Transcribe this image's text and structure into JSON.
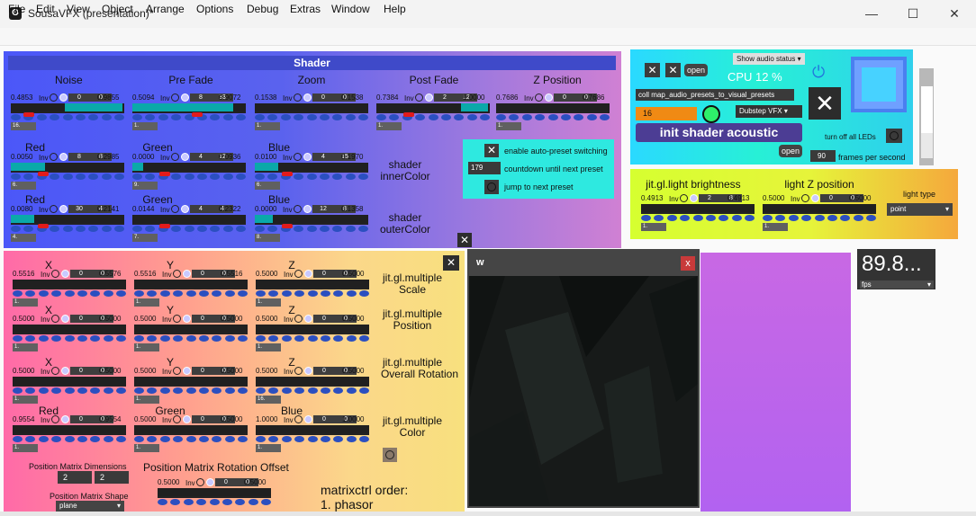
{
  "window": {
    "title": "SousaVFX (presentation)*",
    "min_icon": "minimize-icon",
    "max_icon": "maximize-icon",
    "close_icon": "close-icon"
  },
  "menu": [
    "File",
    "Edit",
    "View",
    "Object",
    "Arrange",
    "Options",
    "Debug",
    "Extras",
    "Window",
    "Help"
  ],
  "shader": {
    "header": "Shader",
    "params": [
      {
        "label": "Noise",
        "left": "0.4853",
        "inv": "Inv",
        "n1": "0",
        "n2": "0",
        "right": "0.9855",
        "msg": "16."
      },
      {
        "label": "Pre Fade",
        "left": "0.5094",
        "inv": "Inv",
        "n1": "8",
        "n2": "33",
        "right": "0.9072",
        "msg": "1."
      },
      {
        "label": "Zoom",
        "left": "0.1538",
        "inv": "Inv",
        "n1": "0",
        "n2": "0",
        "right": "0.1538",
        "msg": "1."
      },
      {
        "label": "Post Fade",
        "left": "0.7384",
        "inv": "Inv",
        "n1": "2",
        "n2": "12",
        "right": "1.0000",
        "msg": "1."
      },
      {
        "label": "Z Position",
        "left": "0.7686",
        "inv": "Inv",
        "n1": "0",
        "n2": "0",
        "right": "0.7686",
        "msg": "1."
      }
    ],
    "inner": [
      {
        "label": "Red",
        "left": "0.0050",
        "inv": "Inv",
        "n1": "8",
        "n2": "8",
        "right": "0.2985",
        "msg": "6."
      },
      {
        "label": "Green",
        "left": "0.0000",
        "inv": "Inv",
        "n1": "4",
        "n2": "12",
        "right": "0.0936",
        "msg": "9."
      },
      {
        "label": "Blue",
        "left": "0.0100",
        "inv": "Inv",
        "n1": "4",
        "n2": "15",
        "right": "0.1970",
        "msg": "6."
      }
    ],
    "inner_label": [
      "shader",
      "innerColor"
    ],
    "outer": [
      {
        "label": "Red",
        "left": "0.0080",
        "inv": "Inv",
        "n1": "30",
        "n2": "4",
        "right": "0.2141",
        "msg": "4."
      },
      {
        "label": "Green",
        "left": "0.0144",
        "inv": "Inv",
        "n1": "4",
        "n2": "4",
        "right": "0.2322",
        "msg": "7."
      },
      {
        "label": "Blue",
        "left": "0.0000",
        "inv": "Inv",
        "n1": "12",
        "n2": "8",
        "right": "0.1358",
        "msg": "8."
      }
    ],
    "outer_label": [
      "shader",
      "outerColor"
    ],
    "autopreset": {
      "enable": "enable auto-preset switching",
      "countdown_value": "179",
      "countdown": "countdown until next preset",
      "jump": "jump to next preset"
    }
  },
  "audio": {
    "open1": "open",
    "show_status": "Show audio status",
    "cpu": "CPU   12 %",
    "coll": "coll map_audio_presets_to_visual_presets",
    "num16": "16",
    "preset": "Dubstep VFX",
    "init": "init shader acoustic",
    "open2": "open",
    "leds": "turn off all LEDs",
    "fps_value": "90",
    "fps_label": "frames per second"
  },
  "light": {
    "brightness": {
      "label": "jit.gl.light brightness",
      "left": "0.4913",
      "inv": "Inv",
      "n1": "2",
      "n2": "8",
      "right": "0.4913",
      "msg": "1."
    },
    "zpos": {
      "label": "light Z position",
      "left": "0.5000",
      "inv": "Inv",
      "n1": "0",
      "n2": "0",
      "right": "0.5000",
      "msg": "1."
    },
    "type_label": "light type",
    "type_value": "point"
  },
  "multiple": {
    "scale": {
      "labels": [
        "X",
        "Y",
        "Z"
      ],
      "title": [
        "jit.gl.multiple",
        "Scale"
      ],
      "rows": [
        {
          "left": "0.5516",
          "inv": "Inv",
          "n1": "0",
          "n2": "0",
          "right": "0.5576",
          "msg": "1."
        },
        {
          "left": "0.5516",
          "inv": "Inv",
          "n1": "0",
          "n2": "0",
          "right": "0.5516",
          "msg": "1."
        },
        {
          "left": "0.5000",
          "inv": "Inv",
          "n1": "0",
          "n2": "0",
          "right": "0.5000",
          "msg": "1."
        }
      ]
    },
    "position": {
      "labels": [
        "X",
        "Y",
        "Z"
      ],
      "title": [
        "jit.gl.multiple",
        "Position"
      ],
      "rows": [
        {
          "left": "0.5000",
          "inv": "Inv",
          "n1": "0",
          "n2": "0",
          "right": "0.5000",
          "msg": "1."
        },
        {
          "left": "0.5000",
          "inv": "Inv",
          "n1": "0",
          "n2": "0",
          "right": "0.5000",
          "msg": "1."
        },
        {
          "left": "0.5000",
          "inv": "Inv",
          "n1": "0",
          "n2": "0",
          "right": "0.5000",
          "msg": "1."
        }
      ]
    },
    "rotation": {
      "labels": [
        "X",
        "Y",
        "Z"
      ],
      "title": [
        "jit.gl.multiple",
        "Overall Rotation"
      ],
      "rows": [
        {
          "left": "0.5000",
          "inv": "Inv",
          "n1": "0",
          "n2": "0",
          "right": "0.5000",
          "msg": "1."
        },
        {
          "left": "0.5000",
          "inv": "Inv",
          "n1": "0",
          "n2": "0",
          "right": "0.5000",
          "msg": "1."
        },
        {
          "left": "0.5000",
          "inv": "Inv",
          "n1": "0",
          "n2": "0",
          "right": "0.5000",
          "msg": "16."
        }
      ]
    },
    "color": {
      "labels": [
        "Red",
        "Green",
        "Blue"
      ],
      "title": [
        "jit.gl.multiple",
        "Color"
      ],
      "rows": [
        {
          "left": "0.9554",
          "inv": "Inv",
          "n1": "0",
          "n2": "0",
          "right": "0.9554",
          "msg": "1."
        },
        {
          "left": "0.5000",
          "inv": "Inv",
          "n1": "0",
          "n2": "0",
          "right": "0.5000",
          "msg": "1."
        },
        {
          "left": "1.0000",
          "inv": "Inv",
          "n1": "0",
          "n2": "0",
          "right": "1.0000",
          "msg": "1."
        }
      ]
    },
    "dims_label": "Position Matrix Dimensions",
    "dim1": "2",
    "dim2": "2",
    "rot_offset_label": "Position Matrix Rotation Offset",
    "rot_offset": {
      "left": "0.5000",
      "inv": "Inv",
      "n1": "0",
      "n2": "0",
      "right": "0.5000"
    },
    "shape_label": "Position Matrix Shape",
    "shape_value": "plane",
    "order1": "matrixctrl order:",
    "order2": "1. phasor"
  },
  "preview": {
    "title": "w",
    "close": "x"
  },
  "fps": {
    "value": "89.8...",
    "unit": "fps"
  }
}
